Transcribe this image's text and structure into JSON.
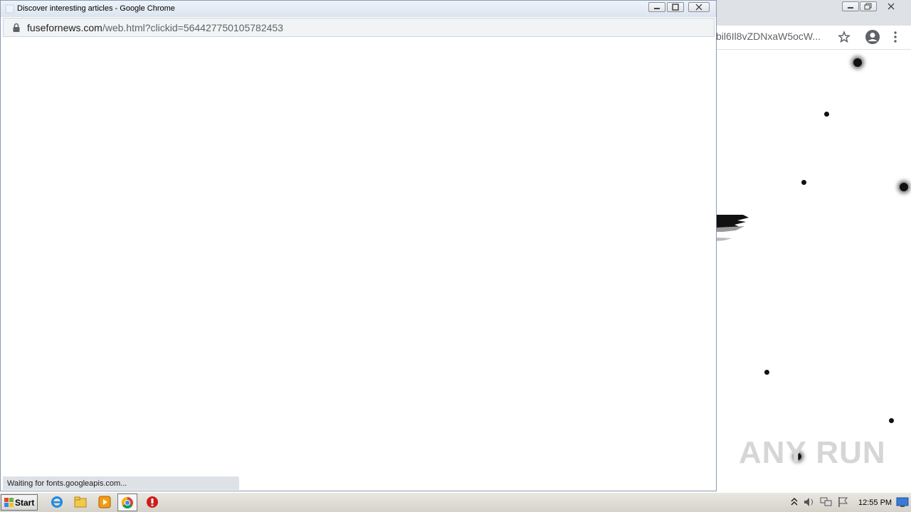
{
  "popup": {
    "title": "Discover interesting articles - Google Chrome",
    "url_host": "fusefornews.com",
    "url_path": "/web.html?clickid=564427750105782453",
    "status": "Waiting for fonts.googleapis.com..."
  },
  "background_window": {
    "url_fragment": "bil6Il8vZDNxaW5ocW..."
  },
  "taskbar": {
    "start_label": "Start",
    "clock": "12:55 PM"
  },
  "watermark": "ANY RUN"
}
